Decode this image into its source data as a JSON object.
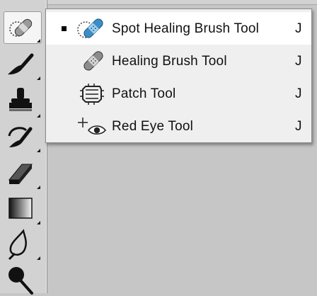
{
  "toolbar": {
    "tools": [
      {
        "name": "spot-healing-brush-tool-button",
        "icon": "bandage-icon",
        "active": true
      },
      {
        "name": "brush-tool-button",
        "icon": "brush-icon"
      },
      {
        "name": "clone-stamp-tool-button",
        "icon": "stamp-icon"
      },
      {
        "name": "history-brush-tool-button",
        "icon": "history-brush-icon"
      },
      {
        "name": "eraser-tool-button",
        "icon": "eraser-icon"
      },
      {
        "name": "gradient-tool-button",
        "icon": "gradient-icon"
      },
      {
        "name": "blur-tool-button",
        "icon": "drop-icon"
      },
      {
        "name": "dodge-tool-button",
        "icon": "dodge-icon"
      }
    ]
  },
  "flyout": {
    "items": [
      {
        "label": "Spot Healing Brush Tool",
        "shortcut": "J",
        "icon": "spot-healing-brush-icon",
        "selected": true
      },
      {
        "label": "Healing Brush Tool",
        "shortcut": "J",
        "icon": "healing-brush-icon",
        "selected": false
      },
      {
        "label": "Patch Tool",
        "shortcut": "J",
        "icon": "patch-icon",
        "selected": false
      },
      {
        "label": "Red Eye Tool",
        "shortcut": "J",
        "icon": "red-eye-icon",
        "selected": false
      }
    ]
  },
  "colors": {
    "accent_blue": "#3a8fc8",
    "menu_bg": "#efefef",
    "selected_bg": "#ffffff"
  }
}
